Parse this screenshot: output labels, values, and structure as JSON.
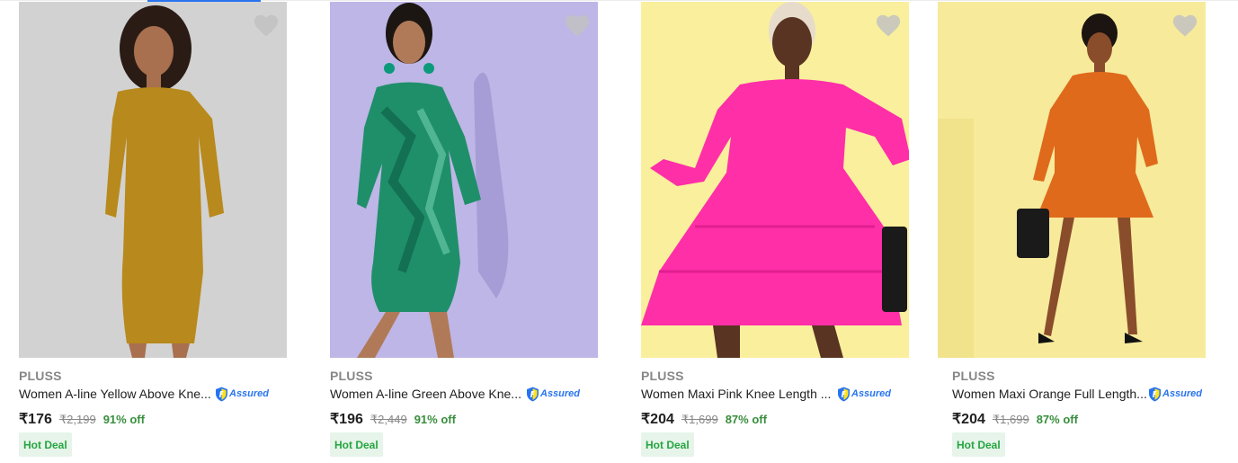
{
  "products": [
    {
      "brand": "PLUSS",
      "title": "Women A-line Yellow Above Knee Dress",
      "title_display": "Women A-line Yellow Above Kne...",
      "assured_label": "Assured",
      "price": "₹176",
      "mrp": "₹2,199",
      "discount": "91% off",
      "deal": "Hot Deal",
      "bg_color": "#d1d1d1",
      "dress_color": "#b8891c"
    },
    {
      "brand": "PLUSS",
      "title": "Women A-line Green Above Knee Dress",
      "title_display": "Women A-line Green Above Kne...",
      "assured_label": "Assured",
      "price": "₹196",
      "mrp": "₹2,449",
      "discount": "91% off",
      "deal": "Hot Deal",
      "bg_color": "#bdb6e6",
      "dress_color": "#1f8f6a"
    },
    {
      "brand": "PLUSS",
      "title": "Women Maxi Pink Knee Length Dress",
      "title_display": "Women Maxi Pink Knee Length ...",
      "assured_label": "Assured",
      "price": "₹204",
      "mrp": "₹1,699",
      "discount": "87% off",
      "deal": "Hot Deal",
      "bg_color": "#f9ef9d",
      "dress_color": "#ff2fa8"
    },
    {
      "brand": "PLUSS",
      "title": "Women Maxi Orange Full Length Dress",
      "title_display": "Women Maxi Orange Full Length...",
      "assured_label": "Assured",
      "price": "₹204",
      "mrp": "₹1,699",
      "discount": "87% off",
      "deal": "Hot Deal",
      "bg_color": "#f7ea9b",
      "dress_color": "#e06a1b"
    }
  ],
  "icons": {
    "wishlist": "heart-icon",
    "assured": "flipkart-assured-badge-icon"
  }
}
